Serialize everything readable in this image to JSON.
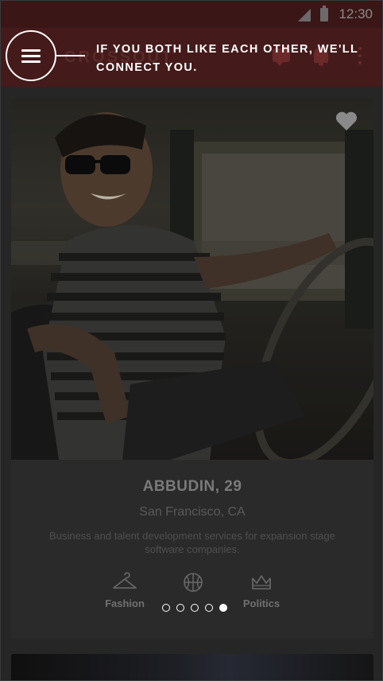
{
  "status_bar": {
    "time": "12:30",
    "signal_icon": "signal-icon",
    "battery_icon": "battery-icon"
  },
  "app_bar": {
    "logo": "CROSSOUT",
    "menu_icon": "hamburger-menu-icon",
    "actions": [
      "chat-icon",
      "bell-icon",
      "more-vert-icon"
    ]
  },
  "coach_mark": {
    "text": "If you both like each other, we'll connect you."
  },
  "profile": {
    "name": "ABBUDIN, 29",
    "location": "San Francisco, CA",
    "bio": "Business and talent development services for expansion stage software companies.",
    "favorite_icon": "heart-icon",
    "interests": [
      {
        "label": "Fashion",
        "icon": "hanger-icon"
      },
      {
        "label": "",
        "icon": "basketball-icon"
      },
      {
        "label": "Politics",
        "icon": "crown-icon"
      }
    ],
    "pager": {
      "count": 5,
      "active_index": 4
    }
  },
  "colors": {
    "app_bar": "#451a1a",
    "overlay_text": "#ffffff",
    "background": "#262626"
  }
}
